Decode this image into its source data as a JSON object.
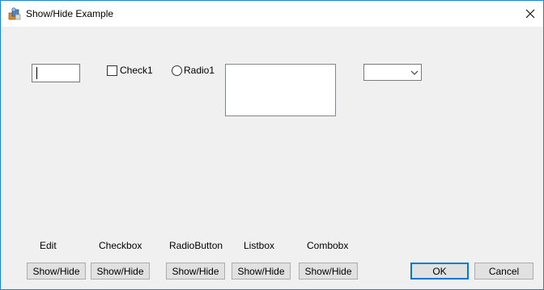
{
  "window": {
    "title": "Show/Hide Example",
    "border_color": "#1883d7",
    "background": "#f0f0f0"
  },
  "controls": {
    "edit_value": "",
    "checkbox": {
      "label": "Check1",
      "checked": false
    },
    "radio": {
      "label": "Radio1",
      "selected": false
    },
    "listbox_items": [],
    "combobox_value": ""
  },
  "labels": {
    "edit": "Edit",
    "checkbox": "Checkbox",
    "radiobutton": "RadioButton",
    "listbox": "Listbox",
    "combobox": "Combobx"
  },
  "buttons": {
    "show_hide_edit": "Show/Hide",
    "show_hide_checkbox": "Show/Hide",
    "show_hide_radio": "Show/Hide",
    "show_hide_listbox": "Show/Hide",
    "show_hide_combobox": "Show/Hide",
    "ok": "OK",
    "cancel": "Cancel"
  },
  "icons": {
    "app": "app-icon",
    "close": "close-icon",
    "dropdown": "chevron-down-icon"
  },
  "colors": {
    "default_button_border": "#0078d7",
    "button_face": "#e1e1e1"
  }
}
